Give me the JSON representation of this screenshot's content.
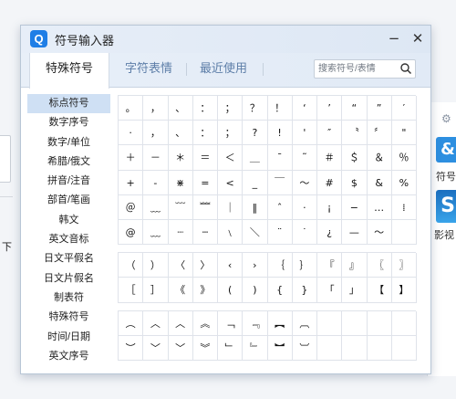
{
  "background": {
    "left_text": "下",
    "right_label_1": "符号",
    "right_label_2": "影视",
    "right_logo_1": "&",
    "right_logo_2": "S"
  },
  "window": {
    "logo": "Q",
    "title": "符号输入器",
    "minimize": "−",
    "close": "✕"
  },
  "tabs": [
    {
      "label": "特殊符号",
      "active": true
    },
    {
      "label": "字符表情",
      "active": false
    },
    {
      "label": "最近使用",
      "active": false
    }
  ],
  "search": {
    "placeholder": "搜索符号/表情",
    "value": ""
  },
  "sidebar": {
    "items": [
      {
        "label": "标点符号",
        "active": true
      },
      {
        "label": "数字序号"
      },
      {
        "label": "数字/单位"
      },
      {
        "label": "希腊/俄文"
      },
      {
        "label": "拼音/注音"
      },
      {
        "label": "部首/笔画"
      },
      {
        "label": "韩文"
      },
      {
        "label": "英文音标"
      },
      {
        "label": "日文平假名"
      },
      {
        "label": "日文片假名"
      },
      {
        "label": "制表符"
      },
      {
        "label": "特殊符号"
      },
      {
        "label": "时间/日期"
      },
      {
        "label": "英文序号"
      }
    ]
  },
  "symbol_groups": [
    {
      "rows": [
        [
          "。",
          "，",
          "、",
          "：",
          "；",
          "？",
          "！",
          "‘",
          "’",
          "“",
          "”",
          "′"
        ],
        [
          "·",
          "，",
          "、",
          "：",
          "；",
          "?",
          "!",
          "'",
          "″",
          "〝",
          "〞",
          "\""
        ],
        [
          "＋",
          "－",
          "＊",
          "＝",
          "＜",
          "＿",
          "ˉ",
          "˜",
          "＃",
          "＄",
          "＆",
          "％"
        ],
        [
          "+",
          "-",
          "⋇",
          "=",
          "<",
          "_",
          "￣",
          "～",
          "#",
          "$",
          "&",
          "%"
        ],
        [
          "＠",
          "﹏",
          "﹋",
          "﹌",
          "｜",
          "‖",
          "ˆ",
          "·",
          "¡",
          "−",
          "…",
          "⁞"
        ],
        [
          "@",
          "﹏",
          "┈",
          "┄",
          "﹨",
          "＼",
          "¨",
          "˙",
          "¿",
          "—",
          "～",
          ""
        ]
      ]
    },
    {
      "rows": [
        [
          "（",
          "）",
          "〈",
          "〉",
          "‹",
          "›",
          "｛",
          "｝",
          "『",
          "』",
          "〖",
          "〗"
        ],
        [
          "［",
          "］",
          "《",
          "》",
          "(",
          ")",
          "{",
          "}",
          "「",
          "」",
          "【",
          "】"
        ]
      ]
    },
    {
      "rows": [
        [
          "︵",
          "︿",
          "︿",
          "︽",
          "﹁",
          "﹃",
          "︻",
          "︹",
          "",
          "",
          "",
          ""
        ],
        [
          "︶",
          "﹀",
          "﹀",
          "︾",
          "﹂",
          "﹄",
          "︼",
          "︺",
          "",
          "",
          "",
          ""
        ]
      ]
    }
  ]
}
